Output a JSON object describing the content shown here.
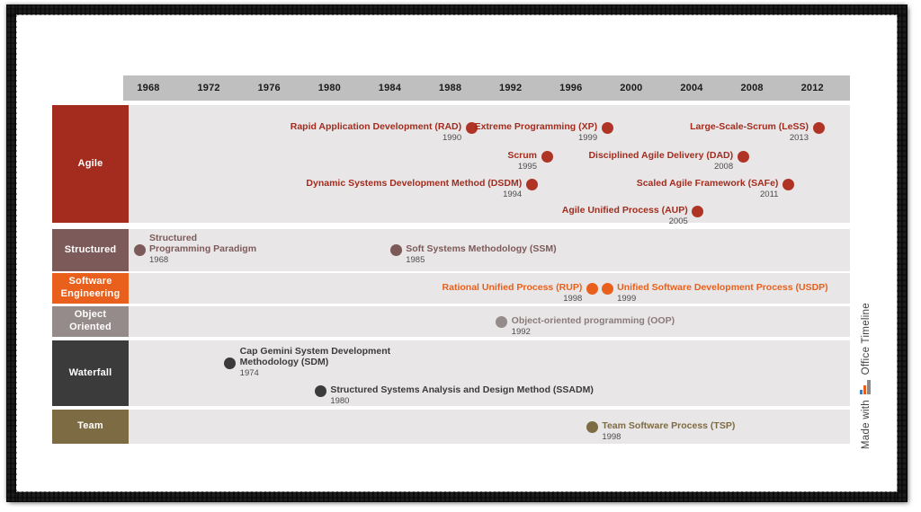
{
  "axis": {
    "start_year": 1968,
    "end_year": 2013,
    "ticks": [
      1968,
      1972,
      1976,
      1980,
      1984,
      1988,
      1992,
      1996,
      2000,
      2004,
      2008,
      2012
    ],
    "background_color": "#bfbfbf"
  },
  "branding": {
    "made_with": "Made with",
    "product": "Office Timeline",
    "logo_icon": "office-timeline-bars-icon"
  },
  "lanes": [
    {
      "label": "Agile",
      "color": "#a32c1e",
      "text_color": "#a32c1e",
      "marker_color": "#b03426"
    },
    {
      "label": "Structured",
      "color": "#7d5a5a",
      "text_color": "#7d5a5a",
      "marker_color": "#7d5a5a"
    },
    {
      "label": "Software\nEngineering",
      "color": "#e8601c",
      "text_color": "#e8601c",
      "marker_color": "#e8601c"
    },
    {
      "label": "Object\nOriented",
      "color": "#968b8b",
      "text_color": "#8a7b7b",
      "marker_color": "#968b8b"
    },
    {
      "label": "Waterfall",
      "color": "#3b3b3b",
      "text_color": "#3b3b3b",
      "marker_color": "#3b3b3b"
    },
    {
      "label": "Team",
      "color": "#7d6b44",
      "text_color": "#7d6b44",
      "marker_color": "#7d6b44"
    }
  ],
  "chart_data": {
    "type": "timeline",
    "title": "Software Development Methodologies Timeline",
    "xlabel": "",
    "ylabel": "",
    "xlim": [
      1968,
      2013
    ],
    "grid": false,
    "legend": "none",
    "categories": [
      "Agile",
      "Structured",
      "Software Engineering",
      "Object Oriented",
      "Waterfall",
      "Team"
    ],
    "milestones": [
      {
        "lane": "Agile",
        "label": "Rapid Application Development (RAD)",
        "year": 1990,
        "side": "left",
        "sub_row": 0
      },
      {
        "lane": "Agile",
        "label": "Extreme Programming (XP)",
        "year": 1999,
        "side": "left",
        "sub_row": 0
      },
      {
        "lane": "Agile",
        "label": "Large-Scale-Scrum (LeSS)",
        "year": 2013,
        "side": "left",
        "sub_row": 0
      },
      {
        "lane": "Agile",
        "label": "Scrum",
        "year": 1995,
        "side": "left",
        "sub_row": 1
      },
      {
        "lane": "Agile",
        "label": "Disciplined Agile Delivery (DAD)",
        "year": 2008,
        "side": "left",
        "sub_row": 1
      },
      {
        "lane": "Agile",
        "label": "Dynamic Systems Development Method (DSDM)",
        "year": 1994,
        "side": "left",
        "sub_row": 2
      },
      {
        "lane": "Agile",
        "label": "Scaled Agile Framework (SAFe)",
        "year": 2011,
        "side": "left",
        "sub_row": 2
      },
      {
        "lane": "Agile",
        "label": "Agile Unified Process (AUP)",
        "year": 2005,
        "side": "left",
        "sub_row": 3
      },
      {
        "lane": "Structured",
        "label": "Structured\nProgramming Paradigm",
        "year": 1968,
        "side": "right",
        "sub_row": 0
      },
      {
        "lane": "Structured",
        "label": "Soft Systems Methodology (SSM)",
        "year": 1985,
        "side": "right",
        "sub_row": 0
      },
      {
        "lane": "Software Engineering",
        "label": "Rational Unified Process (RUP)",
        "year": 1998,
        "side": "left",
        "sub_row": 0
      },
      {
        "lane": "Software Engineering",
        "label": "Unified Software Development Process (USDP)",
        "year": 1999,
        "side": "right",
        "sub_row": 0
      },
      {
        "lane": "Object Oriented",
        "label": "Object-oriented programming (OOP)",
        "year": 1992,
        "side": "right",
        "sub_row": 0
      },
      {
        "lane": "Waterfall",
        "label": "Cap Gemini System Development\nMethodology (SDM)",
        "year": 1974,
        "side": "right",
        "sub_row": 0
      },
      {
        "lane": "Waterfall",
        "label": "Structured Systems Analysis and Design Method (SSADM)",
        "year": 1980,
        "side": "right",
        "sub_row": 1
      },
      {
        "lane": "Team",
        "label": "Team Software Process (TSP)",
        "year": 1998,
        "side": "right",
        "sub_row": 0
      }
    ]
  }
}
